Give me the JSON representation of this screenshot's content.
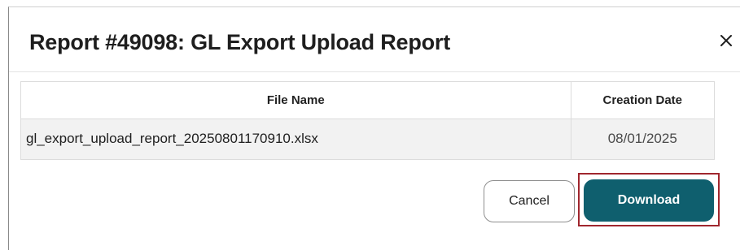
{
  "dialog": {
    "title": "Report #49098: GL Export Upload Report",
    "close_icon": "close-icon"
  },
  "table": {
    "columns": [
      "File Name",
      "Creation Date"
    ],
    "rows": [
      {
        "file_name": "gl_export_upload_report_20250801170910.xlsx",
        "creation_date": "08/01/2025"
      }
    ]
  },
  "footer": {
    "cancel_label": "Cancel",
    "download_label": "Download"
  },
  "colors": {
    "primary_button": "#0f5f6e",
    "highlight_border": "#a0262e"
  }
}
